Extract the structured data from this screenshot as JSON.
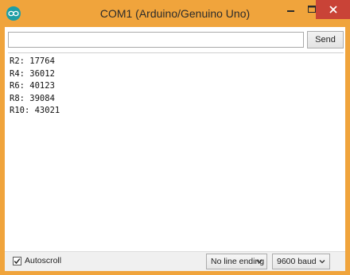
{
  "window": {
    "title": "COM1 (Arduino/Genuino Uno)",
    "accent_color": "#f0a43c",
    "close_color": "#c94337"
  },
  "input": {
    "value": "",
    "placeholder": ""
  },
  "send_label": "Send",
  "output_lines": [
    "R2: 17764",
    "R4: 36012",
    "R6: 40123",
    "R8: 39084",
    "R10: 43021"
  ],
  "status": {
    "autoscroll_label": "Autoscroll",
    "autoscroll_checked": true,
    "line_ending": "No line ending",
    "baud": "9600 baud"
  }
}
